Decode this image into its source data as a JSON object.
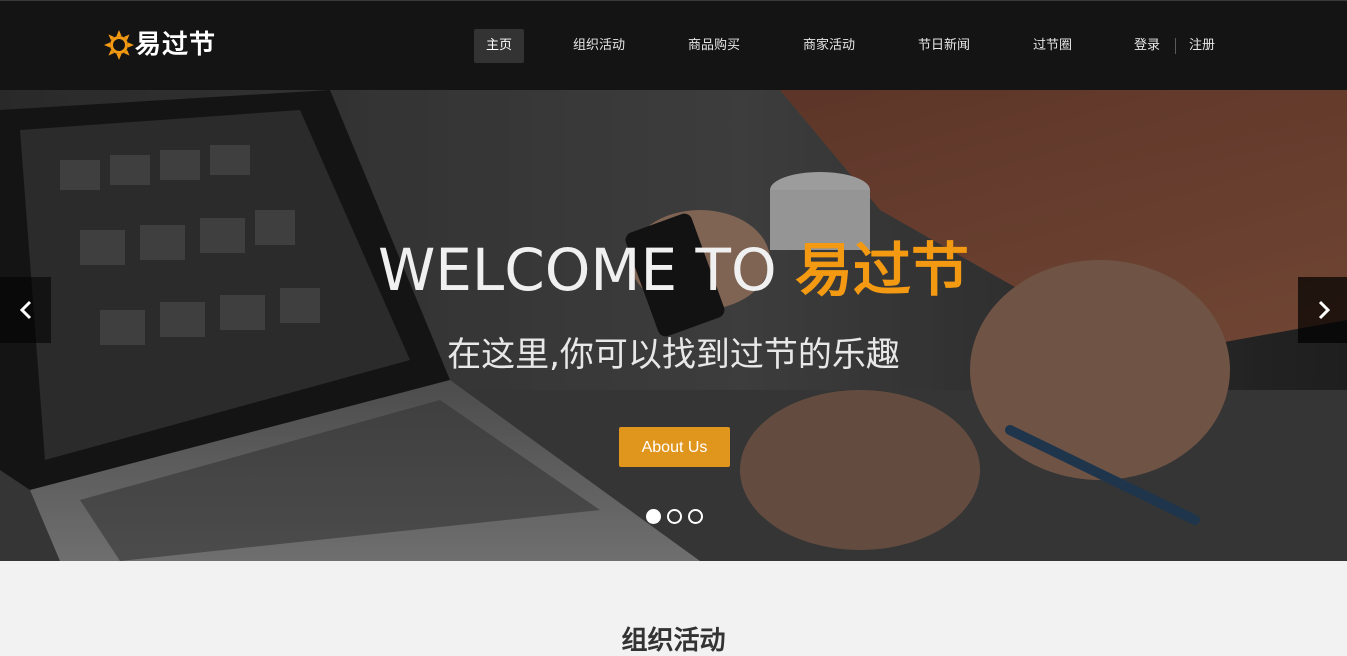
{
  "brand": {
    "name": "易过节",
    "icon": "sun-icon",
    "accent_color": "#f39a12"
  },
  "nav": {
    "items": [
      {
        "label": "主页",
        "active": true
      },
      {
        "label": "组织活动"
      },
      {
        "label": "商品购买"
      },
      {
        "label": "商家活动"
      },
      {
        "label": "节日新闻"
      },
      {
        "label": "过节圈"
      }
    ],
    "login_label": "登录",
    "register_label": "注册"
  },
  "hero": {
    "title_prefix": "WELCOME TO ",
    "title_brand": "易过节",
    "subtitle": "在这里,你可以找到过节的乐趣",
    "button_label": "About Us",
    "button_color": "#e0951c",
    "slide_count": 3,
    "active_slide": 1,
    "prev_icon": "chevron-left-icon",
    "next_icon": "chevron-right-icon"
  },
  "section": {
    "title": "组织活动"
  }
}
